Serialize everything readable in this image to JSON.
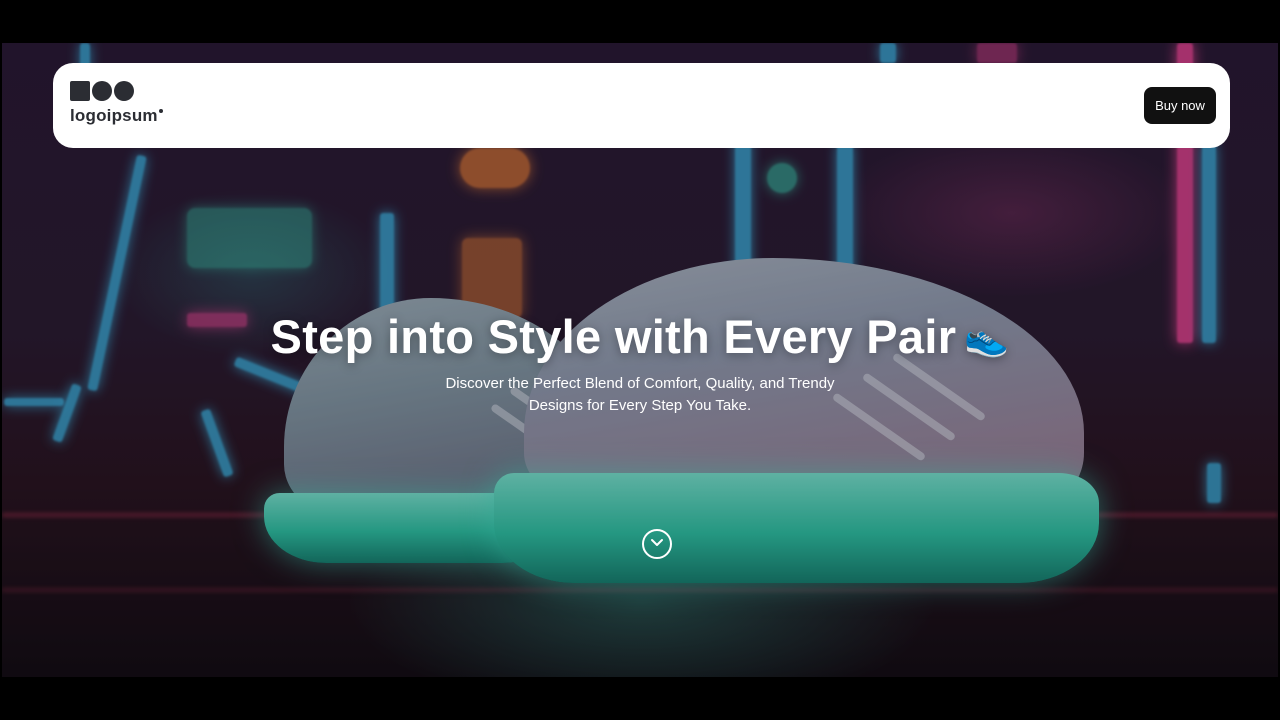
{
  "header": {
    "logo_text": "logoipsum",
    "buy_label": "Buy now"
  },
  "hero": {
    "title": "Step into Style with Every Pair",
    "title_emoji": "👟",
    "subtitle": "Discover the Perfect Blend of Comfort, Quality, and Trendy Designs for Every Step You Take.",
    "scroll_icon": "chevron-down-circle-icon"
  },
  "colors": {
    "page_background": "#000000",
    "header_background": "#ffffff",
    "button_background": "#111111",
    "button_text": "#ffffff",
    "hero_text": "#ffffff",
    "logo": "#2b2d33",
    "sole_glow": "#3fe0c0",
    "neon_pink": "#ff4aa0",
    "neon_cyan": "#3fb8e8"
  }
}
